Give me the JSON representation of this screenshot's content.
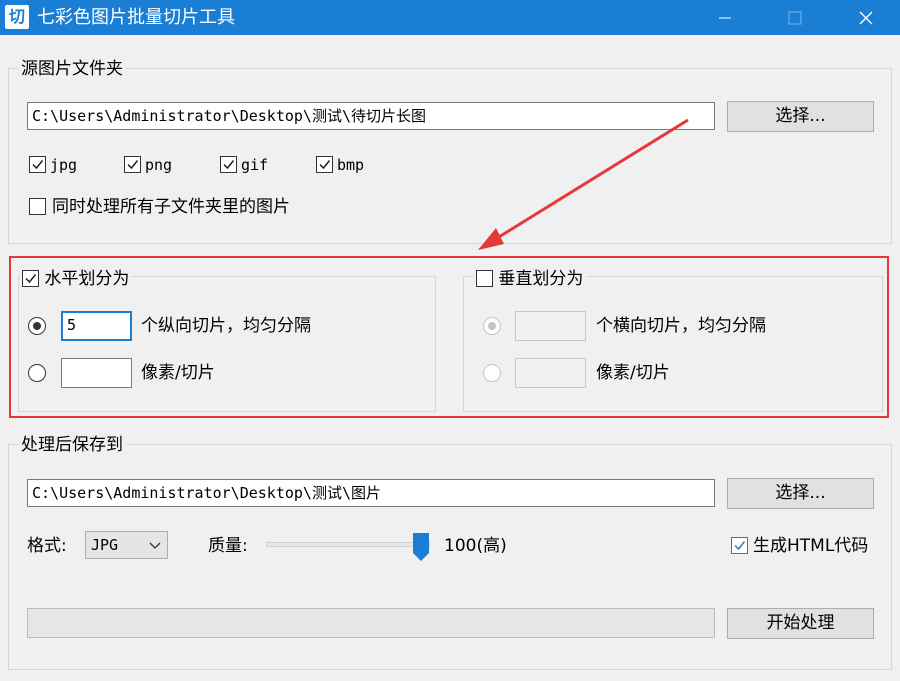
{
  "window": {
    "icon_glyph": "切",
    "title": "七彩色图片批量切片工具",
    "controls": [
      "minimize-icon",
      "maximize-icon",
      "close-icon"
    ]
  },
  "source": {
    "group_label": "源图片文件夹",
    "path_value": "C:\\Users\\Administrator\\Desktop\\测试\\待切片长图",
    "choose_label": "选择...",
    "formats": [
      {
        "label": "jpg",
        "checked": true
      },
      {
        "label": "png",
        "checked": true
      },
      {
        "label": "gif",
        "checked": true
      },
      {
        "label": "bmp",
        "checked": true
      }
    ],
    "subfolders": {
      "label": "同时处理所有子文件夹里的图片",
      "checked": false
    }
  },
  "horizontal": {
    "label": "水平划分为",
    "checked": true,
    "option1_value": "5",
    "option1_suffix": "个纵向切片，均匀分隔",
    "option2_value": "",
    "option2_suffix": "像素/切片",
    "selected_option": 1
  },
  "vertical": {
    "label": "垂直划分为",
    "checked": false,
    "option1_value": "",
    "option1_suffix": "个横向切片，均匀分隔",
    "option2_value": "",
    "option2_suffix": "像素/切片",
    "selected_option": 1
  },
  "output": {
    "group_label": "处理后保存到",
    "path_value": "C:\\Users\\Administrator\\Desktop\\测试\\图片",
    "choose_label": "选择...",
    "format_label": "格式:",
    "format_value": "JPG",
    "quality_label": "质量:",
    "quality_percent": 100,
    "quality_text": "100(高)",
    "html": {
      "label": "生成HTML代码",
      "checked": true
    },
    "start_label": "开始处理",
    "progress_percent": 0
  },
  "colors": {
    "titlebar": "#1a7fd4",
    "highlight_box": "#e5383b",
    "arrow": "#e5383b",
    "accent": "#1a7fd4"
  }
}
